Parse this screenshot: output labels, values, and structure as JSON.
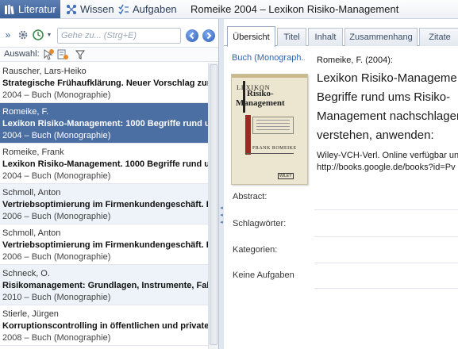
{
  "nav": {
    "tabs": [
      {
        "label": "Literatur",
        "icon": "books-icon",
        "active": true
      },
      {
        "label": "Wissen",
        "icon": "network-icon",
        "active": false
      },
      {
        "label": "Aufgaben",
        "icon": "checklist-icon",
        "active": false
      }
    ],
    "window_title": "Romeike 2004 – Lexikon Risiko-Management"
  },
  "toolbar": {
    "search_placeholder": "Gehe zu... (Strg+E)",
    "filter_label": "Auswahl:"
  },
  "list": {
    "items": [
      {
        "author": "Rauscher, Lars-Heiko",
        "title": "Strategische Frühaufklärung. Neuer Vorschlag zur fi",
        "meta": "2004 – Buch (Monographie)"
      },
      {
        "author": "Romeike, F.",
        "title": "Lexikon Risiko-Management: 1000 Begriffe rund um",
        "meta": "2004 – Buch (Monographie)"
      },
      {
        "author": "Romeike, Frank",
        "title": "Lexikon Risiko-Management. 1000 Begriffe rund ums",
        "meta": "2004 – Buch (Monographie)"
      },
      {
        "author": "Schmoll, Anton",
        "title": "Vertriebsoptimierung im Firmenkundengeschäft. Lö",
        "meta": "2006 – Buch (Monographie)"
      },
      {
        "author": "Schmoll, Anton",
        "title": "Vertriebsoptimierung im Firmenkundengeschäft. Lö",
        "meta": "2006 – Buch (Monographie)"
      },
      {
        "author": "Schneck, O.",
        "title": "Risikomanagement: Grundlagen, Instrumente, Fallbe",
        "meta": "2010 – Buch (Monographie)"
      },
      {
        "author": "Stierle, Jürgen",
        "title": "Korruptionscontrolling in öffentlichen und privaten",
        "meta": "2008 – Buch (Monographie)"
      }
    ],
    "selected_index": 1
  },
  "detail": {
    "tabs": [
      "Übersicht",
      "Titel",
      "Inhalt",
      "Zusammenhang",
      "Zitate"
    ],
    "active_tab": "Übersicht",
    "cover_label": "Buch (Monograph...",
    "cover": {
      "line1": "LEXIKON",
      "line2": "Risiko-",
      "line3": "Management",
      "author": "FRANK ROMEIKE",
      "publisher": "WILEY"
    },
    "citation": {
      "author_year": "Romeike, F. (2004):",
      "title_lines": [
        "Lexikon Risiko-Manageme",
        "Begriffe rund ums Risiko-",
        "Management nachschlager",
        "verstehen, anwenden:"
      ],
      "publisher_lines": [
        "Wiley-VCH-Verl. Online verfügbar unt",
        "http://books.google.de/books?id=Pv"
      ]
    },
    "fields": [
      {
        "label": "Abstract:"
      },
      {
        "label": "Schlagwörter:"
      },
      {
        "label": "Kategorien:"
      },
      {
        "label": "Keine Aufgaben"
      }
    ]
  },
  "colors": {
    "accent": "#3b5f98",
    "selection": "#4b6ea3",
    "link": "#3464a8"
  }
}
